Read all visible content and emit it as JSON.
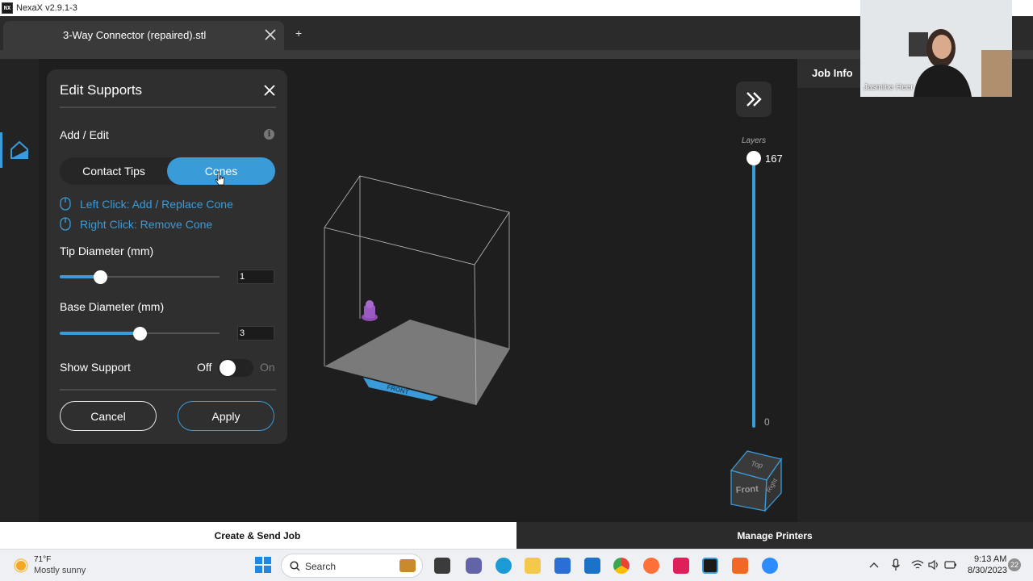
{
  "app": {
    "title": "NexaX v2.9.1-3",
    "icon_text": "NX"
  },
  "tabs": {
    "active_label": "3-Way Connector (repaired).stl",
    "new_tab": "+"
  },
  "job_info": {
    "label": "Job Info"
  },
  "edit_supports": {
    "title": "Edit Supports",
    "section": "Add / Edit",
    "mode_options": [
      "Contact Tips",
      "Cones"
    ],
    "selected_mode": "Cones",
    "hints": [
      "Left Click: Add / Replace Cone",
      "Right Click: Remove Cone"
    ],
    "tip_diameter": {
      "label": "Tip Diameter (mm)",
      "value": "1",
      "slider_fraction": 0.25
    },
    "base_diameter": {
      "label": "Base Diameter (mm)",
      "value": "3",
      "slider_fraction": 0.5
    },
    "show_support": {
      "label": "Show Support",
      "off_label": "Off",
      "on_label": "On",
      "state": "Off"
    },
    "cancel_label": "Cancel",
    "apply_label": "Apply"
  },
  "layers": {
    "label": "Layers",
    "max": "167",
    "min": "0"
  },
  "view_cube": {
    "top": "Top",
    "front": "Front",
    "right": "Right"
  },
  "build_plate": {
    "front_label": "FRONT"
  },
  "bottom_bar": {
    "create_label": "Create & Send Job",
    "manage_label": "Manage Printers"
  },
  "webcam": {
    "name": "Jasmine Heer"
  },
  "taskbar": {
    "weather_temp": "71°F",
    "weather_cond": "Mostly sunny",
    "search_label": "Search",
    "time": "9:13 AM",
    "date": "8/30/2023",
    "notifications": "22"
  },
  "colors": {
    "accent": "#3a9bd9",
    "panel": "#2f2f2f",
    "background": "#1e1e1e"
  }
}
